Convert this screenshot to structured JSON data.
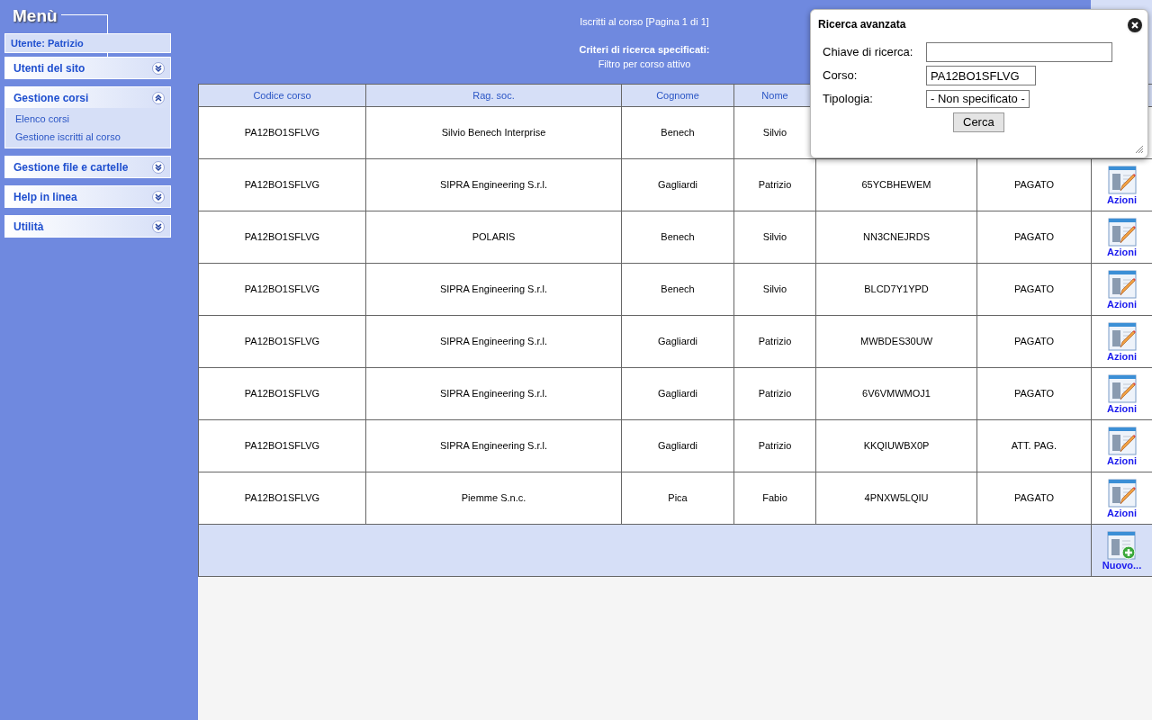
{
  "sidebar": {
    "title": "Menù",
    "user": "Utente: Patrizio",
    "sections": [
      {
        "label": "Utenti del sito",
        "expanded": false
      },
      {
        "label": "Gestione corsi",
        "expanded": true,
        "items": [
          "Elenco corsi",
          "Gestione iscritti al corso"
        ]
      },
      {
        "label": "Gestione file e cartelle",
        "expanded": false
      },
      {
        "label": "Help in linea",
        "expanded": false
      },
      {
        "label": "Utilità",
        "expanded": false
      }
    ]
  },
  "header": {
    "title": "Iscritti al corso [Pagina 1 di 1]",
    "criteria_label": "Criteri di ricerca specificati:",
    "criteria": "Filtro per corso attivo"
  },
  "table": {
    "columns": [
      "Codice corso",
      "Rag. soc.",
      "Cognome",
      "Nome"
    ],
    "rows": [
      {
        "cells": [
          "PA12BO1SFLVG",
          "Silvio Benech Interprise",
          "Benech",
          "Silvio"
        ]
      },
      {
        "cells": [
          "PA12BO1SFLVG",
          "SIPRA Engineering S.r.l.",
          "Gagliardi",
          "Patrizio",
          "65YCBHEWEM",
          "PAGATO"
        ],
        "action": "Azioni"
      },
      {
        "cells": [
          "PA12BO1SFLVG",
          "POLARIS",
          "Benech",
          "Silvio",
          "NN3CNEJRDS",
          "PAGATO"
        ],
        "action": "Azioni"
      },
      {
        "cells": [
          "PA12BO1SFLVG",
          "SIPRA Engineering S.r.l.",
          "Benech",
          "Silvio",
          "BLCD7Y1YPD",
          "PAGATO"
        ],
        "action": "Azioni"
      },
      {
        "cells": [
          "PA12BO1SFLVG",
          "SIPRA Engineering S.r.l.",
          "Gagliardi",
          "Patrizio",
          "MWBDES30UW",
          "PAGATO"
        ],
        "action": "Azioni"
      },
      {
        "cells": [
          "PA12BO1SFLVG",
          "SIPRA Engineering S.r.l.",
          "Gagliardi",
          "Patrizio",
          "6V6VMWMOJ1",
          "PAGATO"
        ],
        "action": "Azioni"
      },
      {
        "cells": [
          "PA12BO1SFLVG",
          "SIPRA Engineering S.r.l.",
          "Gagliardi",
          "Patrizio",
          "KKQIUWBX0P",
          "ATT. PAG."
        ],
        "action": "Azioni"
      },
      {
        "cells": [
          "PA12BO1SFLVG",
          "Piemme S.n.c.",
          "Pica",
          "Fabio",
          "4PNXW5LQIU",
          "PAGATO"
        ],
        "action": "Azioni"
      }
    ],
    "new_button": "Nuovo..."
  },
  "dialog": {
    "title": "Ricerca avanzata",
    "fields": [
      {
        "label": "Chiave di ricerca:",
        "kind": "text"
      },
      {
        "label": "Corso:",
        "kind": "text",
        "value": "PA12BO1SFLVG"
      },
      {
        "label": "Tipologia:",
        "kind": "select",
        "value": "- Non specificato -"
      }
    ],
    "button": "Cerca"
  }
}
